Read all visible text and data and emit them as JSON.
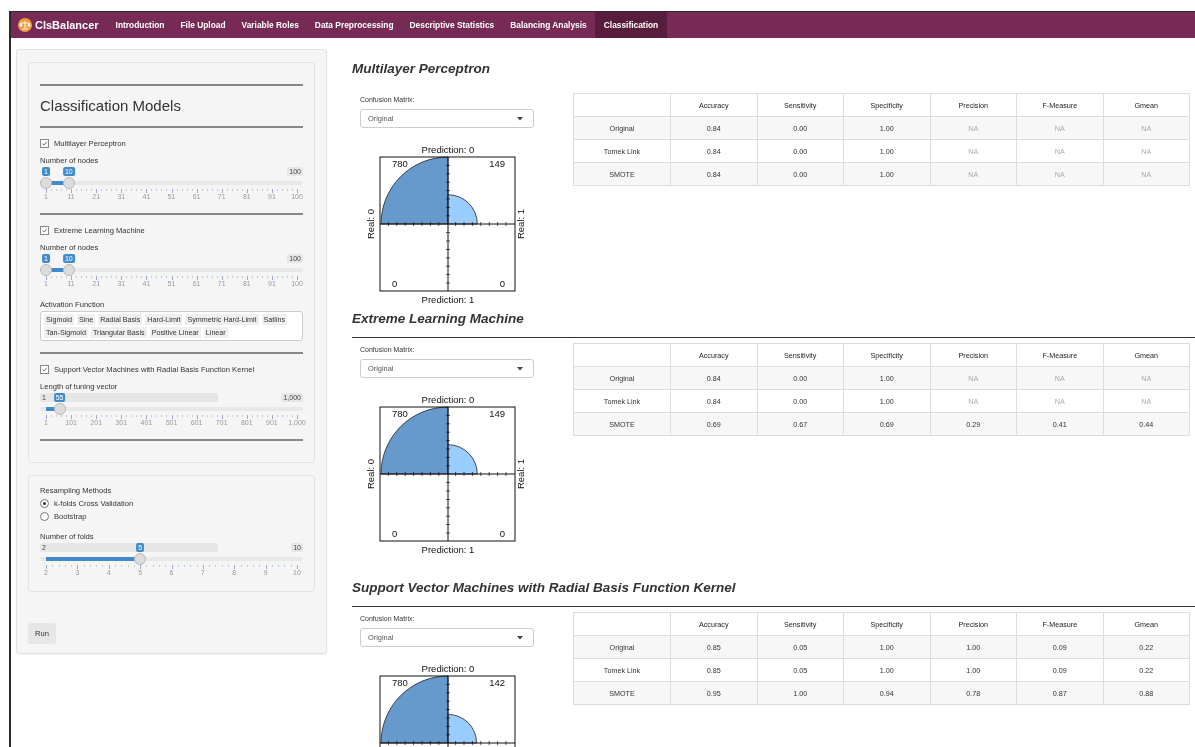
{
  "navbar": {
    "brand": "ClsBalancer",
    "tabs": [
      {
        "label": "Introduction",
        "selected": false
      },
      {
        "label": "File Upload",
        "selected": false
      },
      {
        "label": "Variable Roles",
        "selected": false
      },
      {
        "label": "Data Preprocessing",
        "selected": false
      },
      {
        "label": "Descriptive Statistics",
        "selected": false
      },
      {
        "label": "Balancing Analysis",
        "selected": false
      },
      {
        "label": "Classification",
        "selected": true
      }
    ]
  },
  "sidebar": {
    "heading": "Classification Models",
    "models": [
      {
        "label": "Multilayer Perceptron",
        "checked": true,
        "params": [
          {
            "kind": "slider",
            "label": "Number of nodes",
            "max_label": "100",
            "handles": [
              {
                "value": "1",
                "level": 0
              },
              {
                "value": "10",
                "level": 0.091
              }
            ],
            "ticks": [
              "1",
              "11",
              "21",
              "31",
              "41",
              "51",
              "61",
              "71",
              "81",
              "91",
              "100"
            ]
          }
        ]
      },
      {
        "label": "Extreme Learning Machine",
        "checked": true,
        "params": [
          {
            "kind": "slider",
            "label": "Number of nodes",
            "max_label": "100",
            "handles": [
              {
                "value": "1",
                "level": 0
              },
              {
                "value": "10",
                "level": 0.091
              }
            ],
            "ticks": [
              "1",
              "11",
              "21",
              "31",
              "41",
              "51",
              "61",
              "71",
              "81",
              "91",
              "100"
            ]
          },
          {
            "kind": "tags",
            "label": "Activation Function",
            "tags": [
              "Sigmoid",
              "Sine",
              "Radial Basis",
              "Hard-Limit",
              "Symmetric Hard-Limit",
              "Satlins",
              "Tan-Sigmoid",
              "Triangular Basis",
              "Positive Linear",
              "Linear"
            ]
          }
        ]
      },
      {
        "label": "Support Vector Machines with Radial Basis Function Kernel",
        "checked": true,
        "params": [
          {
            "kind": "slider",
            "label": "Length of tuning vector",
            "min_label": "1",
            "max_label": "1,000",
            "handles": [
              {
                "value": "55",
                "level": 0.054
              }
            ],
            "ticks": [
              "1",
              "101",
              "201",
              "301",
              "401",
              "501",
              "601",
              "701",
              "801",
              "901",
              "1,000"
            ]
          }
        ]
      }
    ],
    "resampling": {
      "label": "Resampling Methods",
      "options": [
        {
          "label": "k-folds Cross Validation",
          "selected": true
        },
        {
          "label": "Bootstrap",
          "selected": false
        }
      ],
      "slider": {
        "kind": "slider",
        "label": "Number of folds",
        "min_label": "2",
        "max_label": "10",
        "handles": [
          {
            "value": "5",
            "level": 0.375
          }
        ],
        "ticks": [
          "2",
          "3",
          "4",
          "5",
          "6",
          "7",
          "8",
          "9",
          "10"
        ]
      }
    },
    "run_button": "Run"
  },
  "sections": [
    {
      "title": "Multilayer Perceptron",
      "select_label": "Confusion Matrix:",
      "select_value": "Original",
      "plot": {
        "top_label": "Prediction: 0",
        "bottom_label": "Prediction: 1",
        "left_label": "Real: 0",
        "right_label": "Real: 1",
        "counts": [
          "780",
          "149",
          "0",
          "0"
        ]
      },
      "table": {
        "columns": [
          "Accuracy",
          "Sensitivity",
          "Specificity",
          "Precision",
          "F-Measure",
          "Gmean"
        ],
        "rows": [
          {
            "label": "Original",
            "cells": [
              {
                "text": "0.84",
                "dimmed": false
              },
              {
                "text": "0.00",
                "dimmed": false
              },
              {
                "text": "1.00",
                "dimmed": false
              },
              {
                "text": "NA",
                "dimmed": true
              },
              {
                "text": "NA",
                "dimmed": true
              },
              {
                "text": "NA",
                "dimmed": true
              }
            ]
          },
          {
            "label": "Tomek Link",
            "cells": [
              {
                "text": "0.84",
                "dimmed": false
              },
              {
                "text": "0.00",
                "dimmed": false
              },
              {
                "text": "1.00",
                "dimmed": false
              },
              {
                "text": "NA",
                "dimmed": true
              },
              {
                "text": "NA",
                "dimmed": true
              },
              {
                "text": "NA",
                "dimmed": true
              }
            ]
          },
          {
            "label": "SMOTE",
            "cells": [
              {
                "text": "0.84",
                "dimmed": false
              },
              {
                "text": "0.00",
                "dimmed": false
              },
              {
                "text": "1.00",
                "dimmed": false
              },
              {
                "text": "NA",
                "dimmed": true
              },
              {
                "text": "NA",
                "dimmed": true
              },
              {
                "text": "NA",
                "dimmed": true
              }
            ]
          }
        ]
      }
    },
    {
      "title": "Extreme Learning Machine",
      "select_label": "Confusion Matrix:",
      "select_value": "Original",
      "plot": {
        "top_label": "Prediction: 0",
        "bottom_label": "Prediction: 1",
        "left_label": "Real: 0",
        "right_label": "Real: 1",
        "counts": [
          "780",
          "149",
          "0",
          "0"
        ]
      },
      "table": {
        "columns": [
          "Accuracy",
          "Sensitivity",
          "Specificity",
          "Precision",
          "F-Measure",
          "Gmean"
        ],
        "rows": [
          {
            "label": "Original",
            "cells": [
              {
                "text": "0.84",
                "dimmed": false
              },
              {
                "text": "0.00",
                "dimmed": false
              },
              {
                "text": "1.00",
                "dimmed": false
              },
              {
                "text": "NA",
                "dimmed": true
              },
              {
                "text": "NA",
                "dimmed": true
              },
              {
                "text": "NA",
                "dimmed": true
              }
            ]
          },
          {
            "label": "Tomek Link",
            "cells": [
              {
                "text": "0.84",
                "dimmed": false
              },
              {
                "text": "0.00",
                "dimmed": false
              },
              {
                "text": "1.00",
                "dimmed": false
              },
              {
                "text": "NA",
                "dimmed": true
              },
              {
                "text": "NA",
                "dimmed": true
              },
              {
                "text": "NA",
                "dimmed": true
              }
            ]
          },
          {
            "label": "SMOTE",
            "cells": [
              {
                "text": "0.69",
                "dimmed": false
              },
              {
                "text": "0.67",
                "dimmed": false
              },
              {
                "text": "0.69",
                "dimmed": false
              },
              {
                "text": "0.29",
                "dimmed": false
              },
              {
                "text": "0.41",
                "dimmed": false
              },
              {
                "text": "0.44",
                "dimmed": false
              }
            ]
          }
        ]
      }
    },
    {
      "title": "Support Vector Machines with Radial Basis Function Kernel",
      "select_label": "Confusion Matrix:",
      "select_value": "Original",
      "plot": {
        "top_label": "Prediction: 0",
        "counts": [
          "780",
          "142"
        ]
      },
      "table": {
        "columns": [
          "Accuracy",
          "Sensitivity",
          "Specificity",
          "Precision",
          "F-Measure",
          "Gmean"
        ],
        "rows": [
          {
            "label": "Original",
            "cells": [
              {
                "text": "0.85",
                "dimmed": false
              },
              {
                "text": "0.05",
                "dimmed": false
              },
              {
                "text": "1.00",
                "dimmed": false
              },
              {
                "text": "1.00",
                "dimmed": false
              },
              {
                "text": "0.09",
                "dimmed": false
              },
              {
                "text": "0.22",
                "dimmed": false
              }
            ]
          },
          {
            "label": "Tomek Link",
            "cells": [
              {
                "text": "0.85",
                "dimmed": false
              },
              {
                "text": "0.05",
                "dimmed": false
              },
              {
                "text": "1.00",
                "dimmed": false
              },
              {
                "text": "1.00",
                "dimmed": false
              },
              {
                "text": "0.09",
                "dimmed": false
              },
              {
                "text": "0.22",
                "dimmed": false
              }
            ]
          },
          {
            "label": "SMOTE",
            "cells": [
              {
                "text": "0.95",
                "dimmed": false
              },
              {
                "text": "1.00",
                "dimmed": false
              },
              {
                "text": "0.94",
                "dimmed": false
              },
              {
                "text": "0.78",
                "dimmed": false
              },
              {
                "text": "0.87",
                "dimmed": false
              },
              {
                "text": "0.88",
                "dimmed": false
              }
            ]
          }
        ]
      }
    }
  ]
}
